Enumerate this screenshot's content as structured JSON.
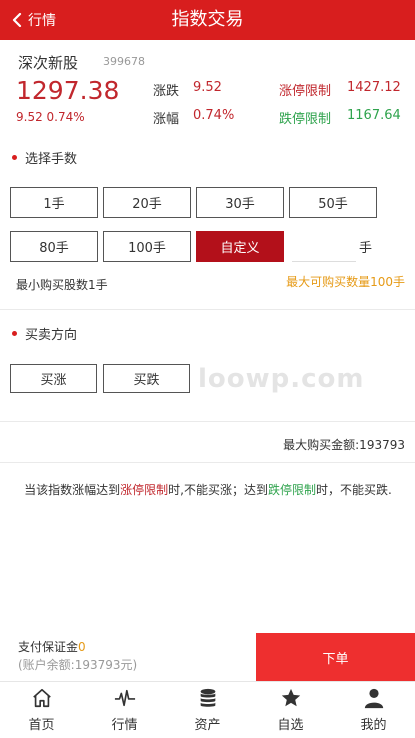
{
  "header": {
    "back_label": "行情",
    "title": "指数交易"
  },
  "stock": {
    "name": "深次新股",
    "code": "399678",
    "price": "1297.38",
    "change_line": "9.52 0.74%",
    "rise_fall_label": "涨跌",
    "rise_fall_value": "9.52",
    "change_pct_label": "涨幅",
    "change_pct_value": "0.74%",
    "limit_up_label": "涨停限制",
    "limit_up_value": "1427.12",
    "limit_down_label": "跌停限制",
    "limit_down_value": "1167.64"
  },
  "lots": {
    "section_title": "选择手数",
    "options": [
      "1手",
      "20手",
      "30手",
      "50手",
      "80手",
      "100手",
      "自定义"
    ],
    "active_option": "自定义",
    "custom_value": "",
    "unit": "手",
    "min_text": "最小购买股数1手",
    "max_text": "最大可购买数量100手"
  },
  "direction": {
    "section_title": "买卖方向",
    "buy_up": "买涨",
    "buy_down": "买跌"
  },
  "watermark": "loowp.com",
  "max_amount_text": "最大购买金额:193793",
  "notice": {
    "part1": "当该指数涨幅达到",
    "limit_up": "涨停限制",
    "part2": "时,不能买涨；达到",
    "limit_down": "跌停限制",
    "part3": "时，不能买跌."
  },
  "payment": {
    "label": "支付保证金",
    "amount": "0",
    "balance": "(账户余额:193793元)",
    "order_button": "下单"
  },
  "tabbar": [
    {
      "label": "首页",
      "icon": "home-icon"
    },
    {
      "label": "行情",
      "icon": "pulse-icon"
    },
    {
      "label": "资产",
      "icon": "coins-icon"
    },
    {
      "label": "自选",
      "icon": "star-icon"
    },
    {
      "label": "我的",
      "icon": "user-icon"
    }
  ],
  "colors": {
    "brand_red": "#d81e1e",
    "up_red": "#c1272d",
    "down_green": "#2fa34d",
    "accent_orange": "#e69a16",
    "order_red": "#ee2f2f"
  }
}
